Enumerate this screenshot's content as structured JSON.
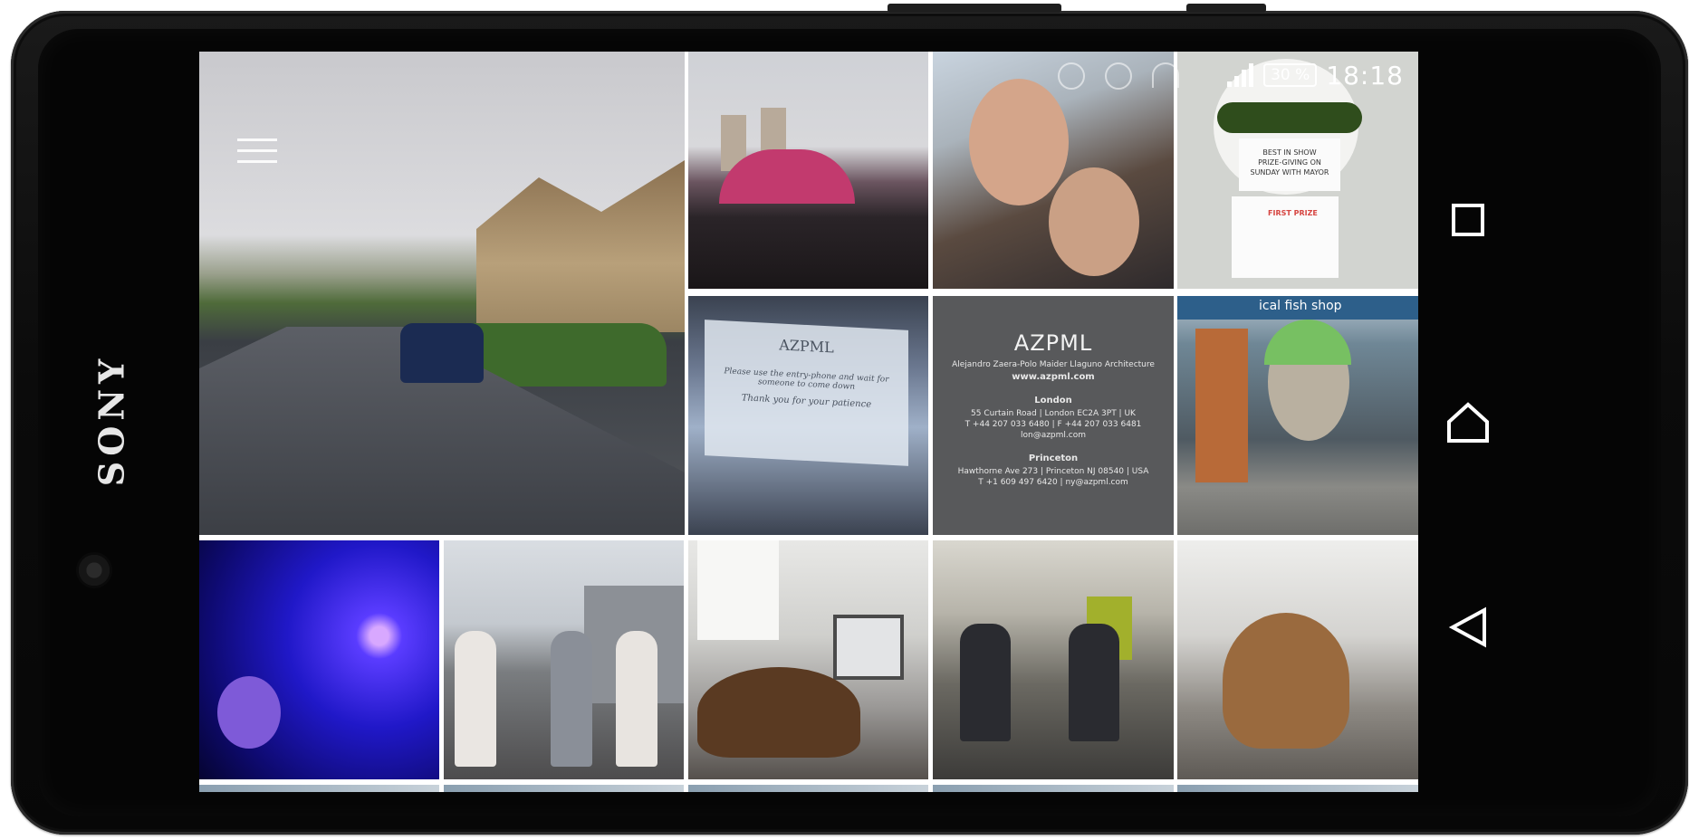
{
  "device": {
    "brand": "SONY"
  },
  "status_bar": {
    "battery": "30 %",
    "time": "18:18",
    "ghost_icons": [
      "do-not-disturb-icon",
      "alarm-icon",
      "wifi-icon"
    ]
  },
  "menu": {
    "icon": "hamburger-menu-icon"
  },
  "gallery": {
    "azpml_card": {
      "title": "AZPML",
      "subtitle": "Alejandro Zaera-Polo Maider Llaguno Architecture",
      "website": "www.azpml.com",
      "london_heading": "London",
      "london_address": "55 Curtain Road | London EC2A 3PT | UK",
      "london_phone": "T +44 207 033 6480 | F +44 207 033 6481",
      "london_email": "lon@azpml.com",
      "princeton_heading": "Princeton",
      "princeton_address": "Hawthorne Ave 273 | Princeton NJ 08540 | USA",
      "princeton_phone": "T +1 609 497 6420 | ny@azpml.com"
    },
    "notice_sign": {
      "title": "AZPML",
      "line1": "Please use the entry-phone and wait for",
      "line2": "someone to come down",
      "line3": "Thank you for your patience"
    },
    "cucumber_card": {
      "line1": "BEST IN SHOW",
      "line2": "PRIZE-GIVING ON",
      "line3": "SUNDAY WITH MAYOR",
      "prize": "FIRST PRIZE"
    },
    "mural_sign": "ical fish shop"
  },
  "nav_bar": {
    "recents": "recents-square-icon",
    "home": "home-icon",
    "back": "back-triangle-icon"
  },
  "colors": {
    "phone_body": "#0b0b0b",
    "azpml_bg": "#58595b",
    "status_text": "#ffffff",
    "prize_red": "#d64541"
  }
}
